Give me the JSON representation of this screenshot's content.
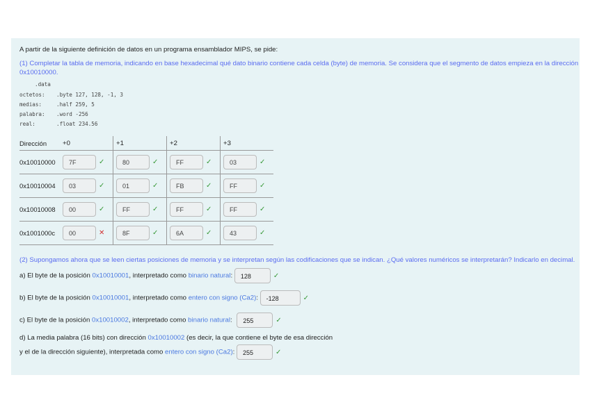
{
  "intro": "A partir de la siguiente definición de datos en un programa ensamblador MIPS, se pide:",
  "part1": {
    "line1": "(1) Completar la tabla de memoria, indicando en base hexadecimal qué dato binario contiene cada celda (byte) de memoria. Se considera que el segmento de datos empieza en la dirección",
    "line2": "0x10010000."
  },
  "code": [
    {
      "label": "",
      "directive": ".data"
    },
    {
      "label": "octetos:",
      "directive": ".byte  127, 128, -1, 3"
    },
    {
      "label": "medias:",
      "directive": ".half 259,  5"
    },
    {
      "label": "palabra:",
      "directive": ".word -256"
    },
    {
      "label": "real:",
      "directive": ".float 234.56"
    }
  ],
  "table": {
    "headers": [
      "Dirección",
      "+0",
      "+1",
      "+2",
      "+3"
    ],
    "rows": [
      {
        "address": "0x10010000",
        "cells": [
          {
            "value": "7F",
            "status": "correct"
          },
          {
            "value": "80",
            "status": "correct"
          },
          {
            "value": "FF",
            "status": "correct"
          },
          {
            "value": "03",
            "status": "correct"
          }
        ]
      },
      {
        "address": "0x10010004",
        "cells": [
          {
            "value": "03",
            "status": "correct"
          },
          {
            "value": "01",
            "status": "correct"
          },
          {
            "value": "FB",
            "status": "correct"
          },
          {
            "value": "FF",
            "status": "correct"
          }
        ]
      },
      {
        "address": "0x10010008",
        "cells": [
          {
            "value": "00",
            "status": "correct"
          },
          {
            "value": "FF",
            "status": "correct"
          },
          {
            "value": "FF",
            "status": "correct"
          },
          {
            "value": "FF",
            "status": "correct"
          }
        ]
      },
      {
        "address": "0x1001000c",
        "cells": [
          {
            "value": "00",
            "status": "incorrect"
          },
          {
            "value": "8F",
            "status": "correct"
          },
          {
            "value": "6A",
            "status": "correct"
          },
          {
            "value": "43",
            "status": "correct"
          }
        ]
      }
    ]
  },
  "part2": {
    "intro": "(2) Supongamos ahora que se leen ciertas posiciones de memoria y se interpretan según las codificaciones que se indican. ¿Qué valores numéricos se interpretarán? Indicarlo en decimal.",
    "a": {
      "p1": "a) El byte de la posición ",
      "addr": "0x10010001",
      "p2": ", interpretado como ",
      "type": "binario natural",
      "p3": ":",
      "answer": "128"
    },
    "b": {
      "p1": "b) El byte de la posición ",
      "addr": "0x10010001",
      "p2": ", interpretado como ",
      "type": "entero con signo (Ca2)",
      "p3": ":",
      "answer": "-128"
    },
    "c": {
      "p1": "c) El byte de la posición ",
      "addr": "0x10010002",
      "p2": ", interpretado como ",
      "type": "binario natural",
      "p3": ":",
      "answer": "255"
    },
    "d": {
      "p1": "d) La media palabra (16 bits) con dirección ",
      "addr": "0x10010002",
      "p2": " (es decir, la que contiene el byte de esa dirección",
      "p3": "y el de la dirección siguiente), interpretada como ",
      "type": "entero con signo (Ca2)",
      "p4": ":",
      "answer": "255"
    }
  },
  "icons": {
    "correct": "✓",
    "incorrect": "✕"
  }
}
